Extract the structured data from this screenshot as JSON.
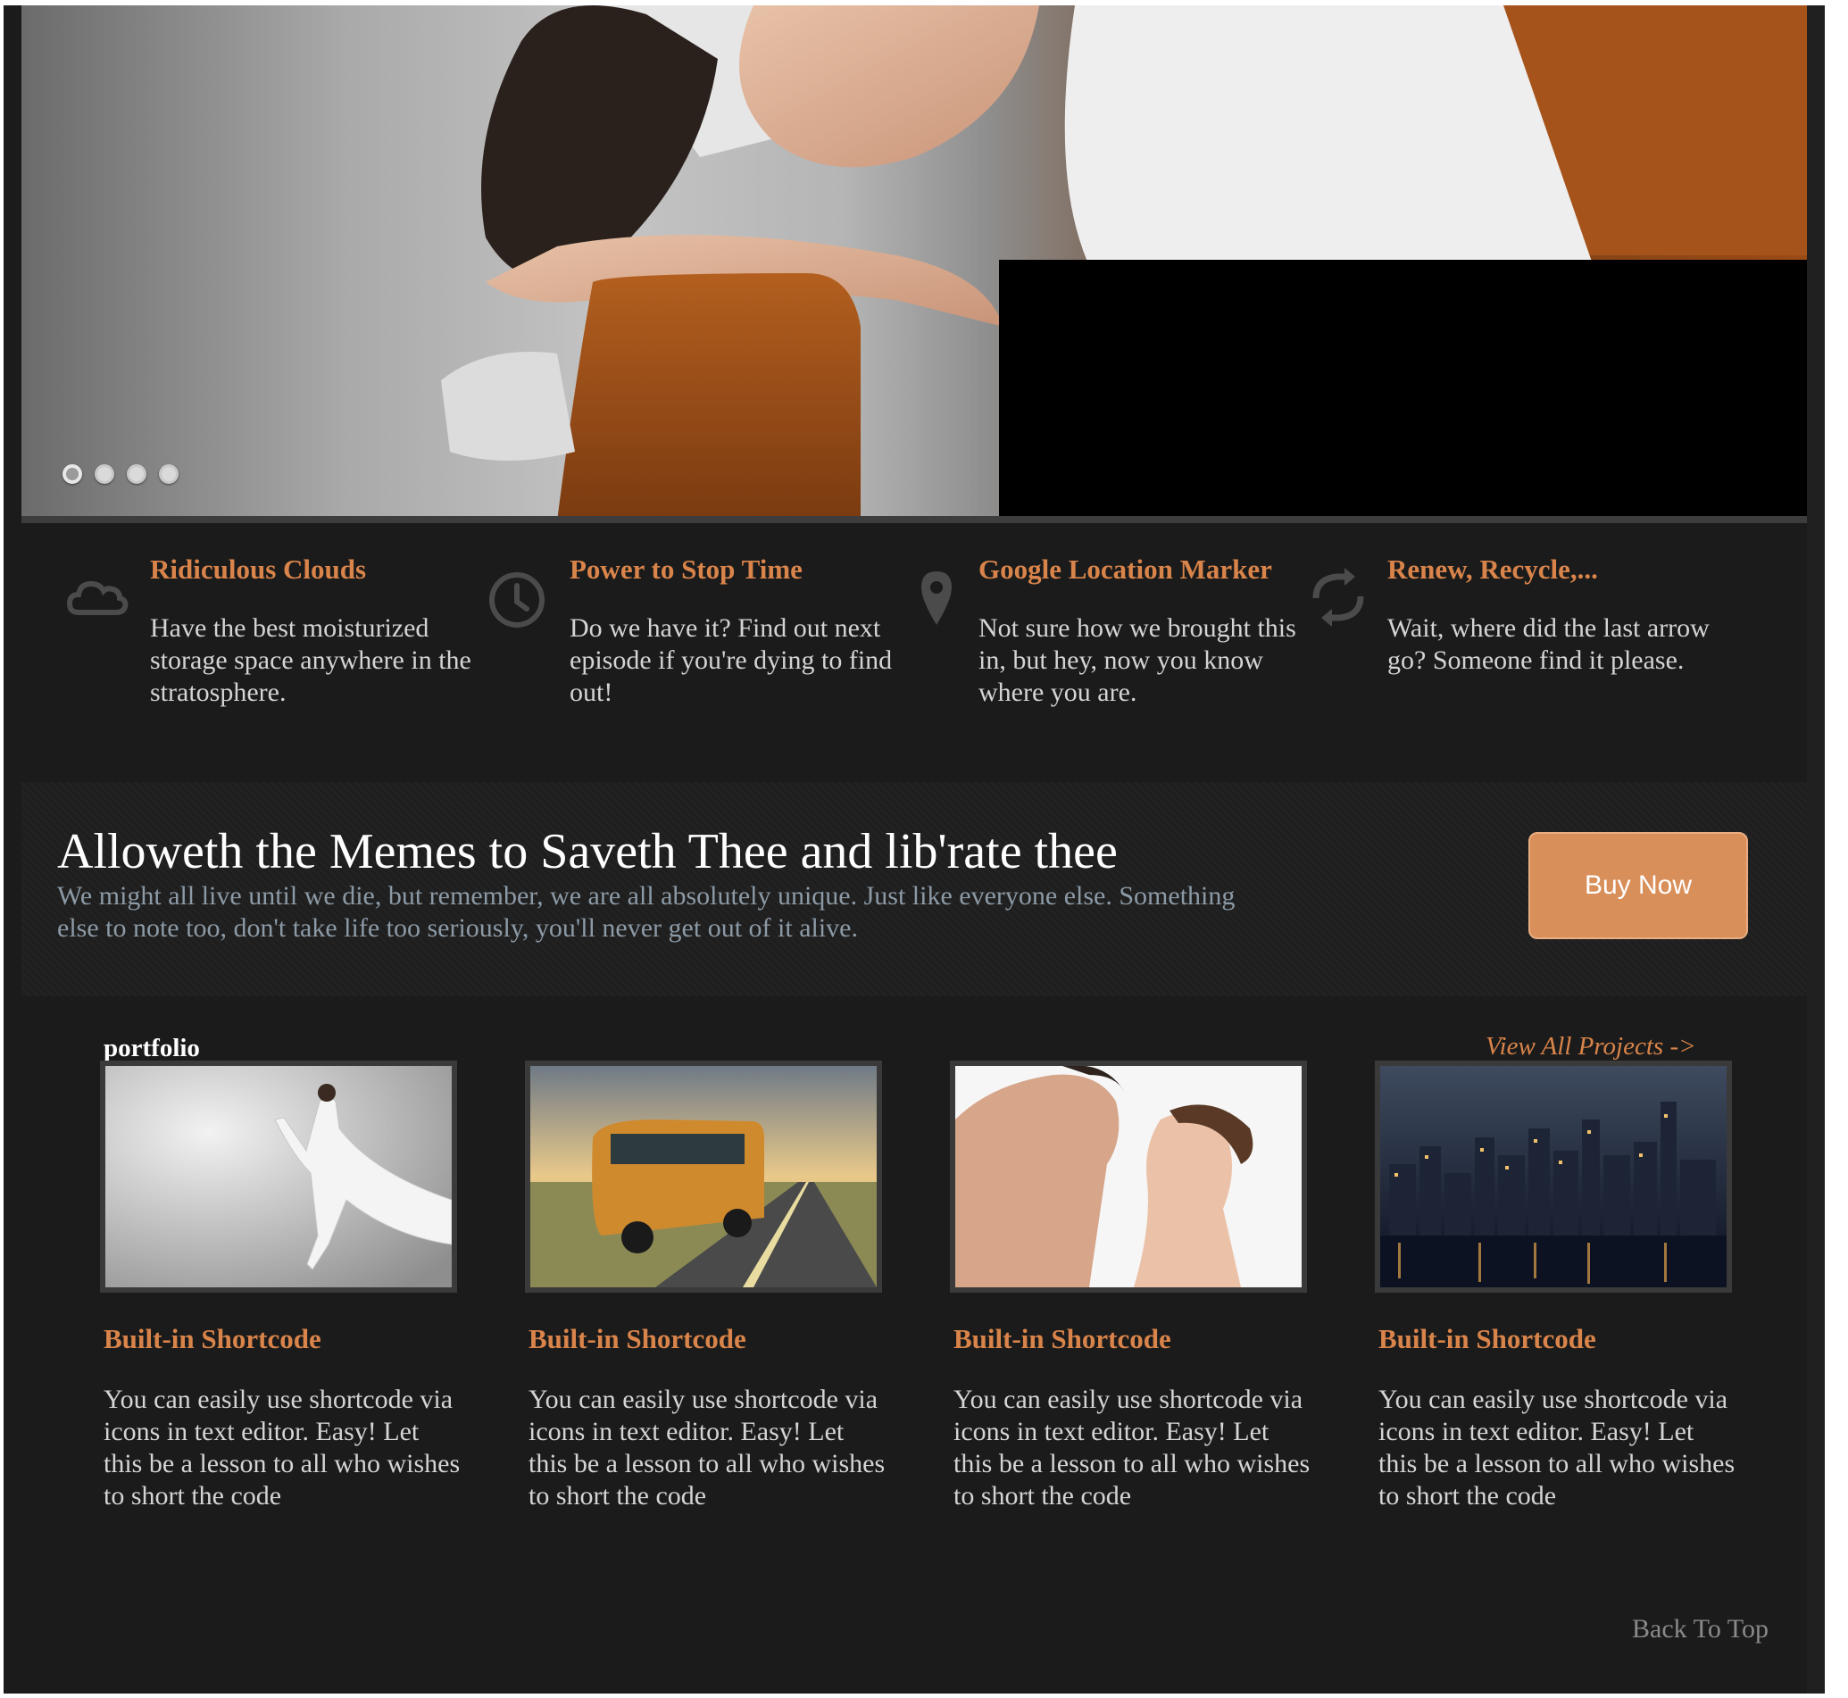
{
  "hero": {
    "slide_count": 4,
    "active_slide": 1
  },
  "features": [
    {
      "icon": "cloud-icon",
      "title": "Ridiculous Clouds",
      "text": "Have the best moisturized storage space anywhere in the stratosphere."
    },
    {
      "icon": "clock-icon",
      "title": "Power to Stop Time",
      "text": "Do we have it? Find out next episode if you're dying to find out!"
    },
    {
      "icon": "map-marker-icon",
      "title": "Google Location Marker",
      "text": "Not sure how we brought this in, but hey, now you know where you are."
    },
    {
      "icon": "refresh-icon",
      "title": "Renew, Recycle,...",
      "text": "Wait, where did the last arrow go? Someone find it please."
    }
  ],
  "banner": {
    "title": "Alloweth the Memes to Saveth Thee and lib'rate thee",
    "subtitle": "We might all live until we die, but remember, we are all absolutely unique. Just like everyone else. Something else to note too, don't take life too seriously, you'll never get out of it alive.",
    "button_label": "Buy Now"
  },
  "portfolio": {
    "label": "portfolio",
    "view_all": "View All Projects ->",
    "items": [
      {
        "title": "Built-in Shortcode",
        "text": "You can easily use shortcode via icons in text editor. Easy! Let this be a lesson to all who wishes to short the code"
      },
      {
        "title": "Built-in Shortcode",
        "text": "You can easily use shortcode via icons in text editor. Easy! Let this be a lesson to all who wishes to short the code"
      },
      {
        "title": "Built-in Shortcode",
        "text": "You can easily use shortcode via icons in text editor. Easy! Let this be a lesson to all who wishes to short the code"
      },
      {
        "title": "Built-in Shortcode",
        "text": "You can easily use shortcode via icons in text editor. Easy! Let this be a lesson to all who wishes to short the code"
      }
    ]
  },
  "footer": {
    "back_to_top": "Back To Top"
  },
  "colors": {
    "accent": "#d9844a",
    "button": "#d98f5a",
    "background": "#1b1b1b",
    "body_text": "#d4d4d4",
    "muted_text": "#8c9aa6"
  }
}
